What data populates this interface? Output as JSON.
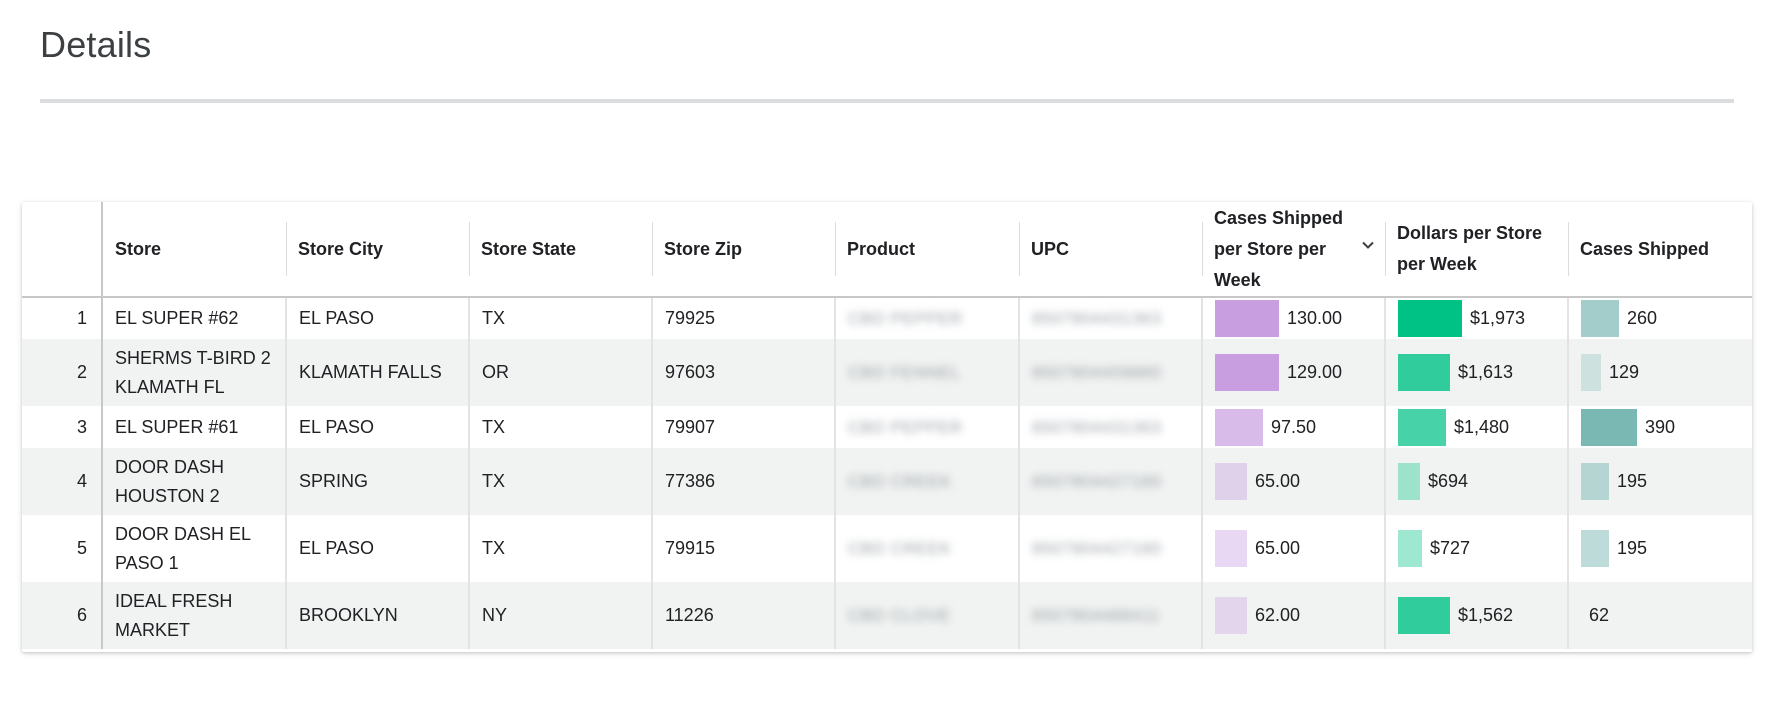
{
  "page": {
    "title": "Details"
  },
  "table": {
    "columns": [
      {
        "key": "store",
        "label": "Store"
      },
      {
        "key": "city",
        "label": "Store City"
      },
      {
        "key": "state",
        "label": "Store State"
      },
      {
        "key": "zip",
        "label": "Store Zip"
      },
      {
        "key": "product",
        "label": "Product"
      },
      {
        "key": "upc",
        "label": "UPC"
      },
      {
        "key": "cases_per_store_week",
        "label": "Cases Shipped per Store per Week",
        "sorted": "descending"
      },
      {
        "key": "dollars_per_store_week",
        "label": "Dollars per Store per Week"
      },
      {
        "key": "cases_shipped",
        "label": "Cases Shipped"
      }
    ],
    "colors": {
      "cases_per_store_week_bar": "#c99ee0",
      "dollars_per_store_week_bar": "#00c285",
      "cases_shipped_bar": "#7ab8b4"
    },
    "rows": [
      {
        "index": "1",
        "store": "EL SUPER #62",
        "city": "EL PASO",
        "state": "TX",
        "zip": "79925",
        "product": "CBD PEPPER",
        "upc": "8507804431363",
        "cases_per_store_week": "130.00",
        "dollars_per_store_week": "$1,973",
        "cases_shipped": "260"
      },
      {
        "index": "2",
        "store": "SHERMS T-BIRD 2 KLAMATH FL",
        "city": "KLAMATH FALLS",
        "state": "OR",
        "zip": "97603",
        "product": "CBD FENNEL",
        "upc": "8507804459880",
        "cases_per_store_week": "129.00",
        "dollars_per_store_week": "$1,613",
        "cases_shipped": "129"
      },
      {
        "index": "3",
        "store": "EL SUPER #61",
        "city": "EL PASO",
        "state": "TX",
        "zip": "79907",
        "product": "CBD PEPPER",
        "upc": "8507804431363",
        "cases_per_store_week": "97.50",
        "dollars_per_store_week": "$1,480",
        "cases_shipped": "390"
      },
      {
        "index": "4",
        "store": "DOOR DASH HOUSTON 2",
        "city": "SPRING",
        "state": "TX",
        "zip": "77386",
        "product": "CBD CREEK",
        "upc": "8507804427180",
        "cases_per_store_week": "65.00",
        "dollars_per_store_week": "$694",
        "cases_shipped": "195"
      },
      {
        "index": "5",
        "store": "DOOR DASH EL PASO 1",
        "city": "EL PASO",
        "state": "TX",
        "zip": "79915",
        "product": "CBD CREEK",
        "upc": "8507804427180",
        "cases_per_store_week": "65.00",
        "dollars_per_store_week": "$727",
        "cases_shipped": "195"
      },
      {
        "index": "6",
        "store": "IDEAL FRESH MARKET",
        "city": "BROOKLYN",
        "state": "NY",
        "zip": "11226",
        "product": "CBD CLOVE",
        "upc": "8507804488411",
        "cases_per_store_week": "62.00",
        "dollars_per_store_week": "$1,562",
        "cases_shipped": "62"
      }
    ]
  }
}
